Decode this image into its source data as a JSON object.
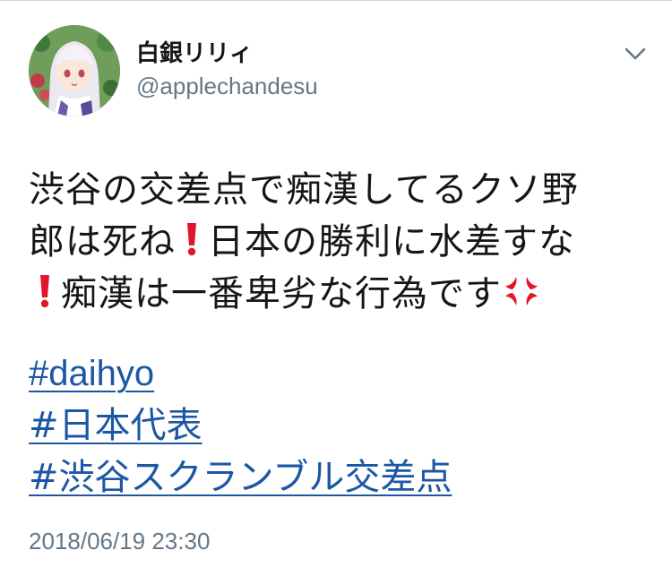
{
  "tweet": {
    "author": {
      "display_name": "白銀リリィ",
      "handle": "@applechandesu",
      "avatar_icon": "anime-girl-avatar-icon"
    },
    "menu_icon": "chevron-down-icon",
    "text_lines": [
      {
        "parts": [
          "渋谷の交差点で痴漢してるクソ野"
        ]
      },
      {
        "parts": [
          "郎は死ね",
          "日本の勝利に水差すな"
        ]
      },
      {
        "parts": [
          "",
          "痴漢は一番卑劣な行為です"
        ]
      }
    ],
    "emoji": {
      "exclamation": "red-exclamation-mark-icon",
      "anger": "anger-symbol-icon"
    },
    "hashtags": [
      "#daihyo",
      "#日本代表",
      "#渋谷スクランブル交差点"
    ],
    "timestamp": "2018/06/19 23:30"
  },
  "colors": {
    "text": "#14171a",
    "secondary": "#657786",
    "link": "#1b57a5",
    "emoji_red": "#e0162b"
  }
}
